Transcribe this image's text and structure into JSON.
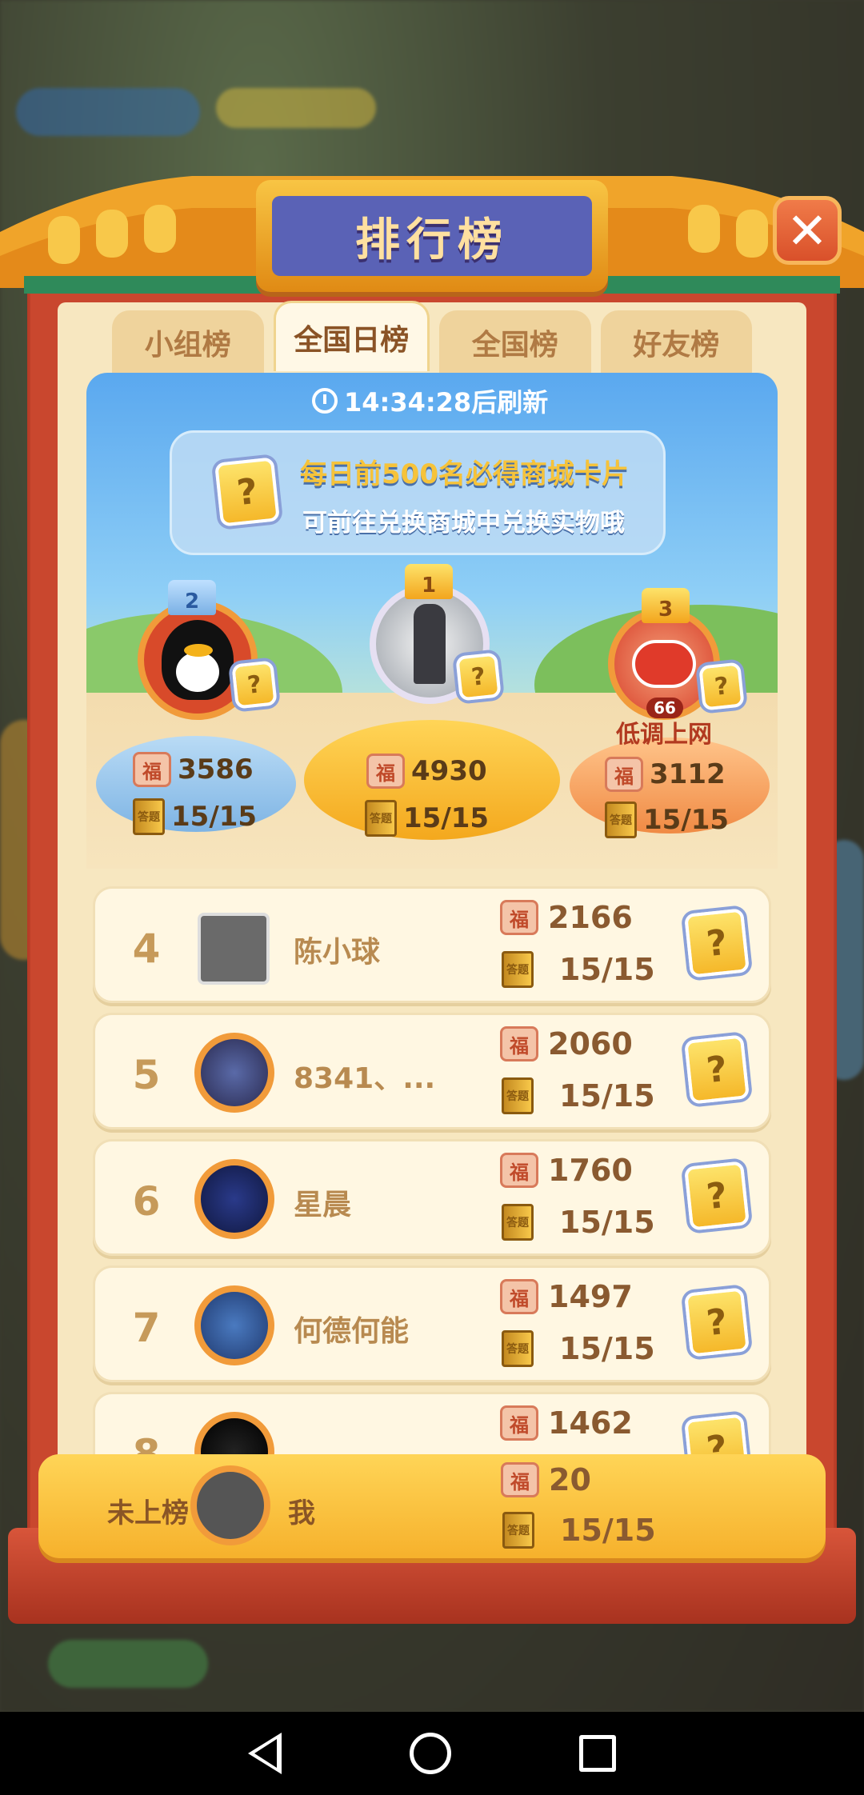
{
  "header": {
    "title": "排行榜"
  },
  "close": {
    "symbol": "✕"
  },
  "tabs": [
    {
      "label": "小组榜"
    },
    {
      "label": "全国日榜"
    },
    {
      "label": "全国榜"
    },
    {
      "label": "好友榜"
    }
  ],
  "refresh": {
    "text": "14:34:28后刷新"
  },
  "banner": {
    "line1": "每日前500名必得商城卡片",
    "line2": "可前往兑换商城中兑换实物哦",
    "icon": "?"
  },
  "podium": [
    {
      "rank": "2",
      "score": "3586",
      "progress": "15/15"
    },
    {
      "rank": "1",
      "score": "4930",
      "progress": "15/15"
    },
    {
      "rank": "3",
      "score": "3112",
      "progress": "15/15",
      "badge": "66",
      "watermark": "低调上网"
    }
  ],
  "icons": {
    "fu": "福",
    "book": "答题",
    "question": "?"
  },
  "rows": [
    {
      "rank": "4",
      "name": "陈小球",
      "score": "2166",
      "progress": "15/15"
    },
    {
      "rank": "5",
      "name": "8341、...",
      "score": "2060",
      "progress": "15/15"
    },
    {
      "rank": "6",
      "name": "星晨",
      "score": "1760",
      "progress": "15/15"
    },
    {
      "rank": "7",
      "name": "何德何能",
      "score": "1497",
      "progress": "15/15"
    },
    {
      "rank": "8",
      "name": "",
      "score": "1462",
      "progress": ""
    }
  ],
  "me": {
    "label": "未上榜",
    "name": "我",
    "score": "20",
    "progress": "15/15"
  }
}
